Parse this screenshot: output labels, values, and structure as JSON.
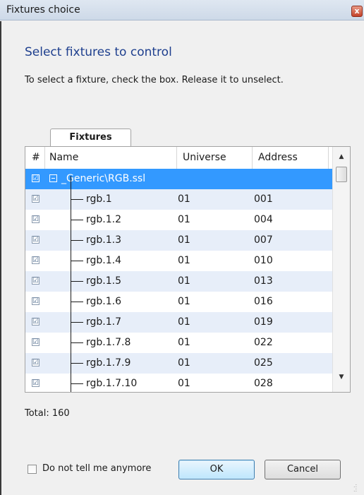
{
  "window": {
    "title": "Fixtures choice",
    "close_label": "x"
  },
  "dialog": {
    "heading": "Select fixtures to control",
    "instructions": "To select a fixture, check the box. Release it to unselect."
  },
  "tab": {
    "label": "Fixtures"
  },
  "grid": {
    "columns": [
      "#",
      "Name",
      "Universe",
      "Address"
    ],
    "group": {
      "checked": true,
      "name": "_Generic\\RGB.ssl"
    },
    "rows": [
      {
        "checked": true,
        "name": "rgb.1",
        "universe": "01",
        "address": "001"
      },
      {
        "checked": true,
        "name": "rgb.1.2",
        "universe": "01",
        "address": "004"
      },
      {
        "checked": true,
        "name": "rgb.1.3",
        "universe": "01",
        "address": "007"
      },
      {
        "checked": true,
        "name": "rgb.1.4",
        "universe": "01",
        "address": "010"
      },
      {
        "checked": true,
        "name": "rgb.1.5",
        "universe": "01",
        "address": "013"
      },
      {
        "checked": true,
        "name": "rgb.1.6",
        "universe": "01",
        "address": "016"
      },
      {
        "checked": true,
        "name": "rgb.1.7",
        "universe": "01",
        "address": "019"
      },
      {
        "checked": true,
        "name": "rgb.1.7.8",
        "universe": "01",
        "address": "022"
      },
      {
        "checked": true,
        "name": "rgb.1.7.9",
        "universe": "01",
        "address": "025"
      },
      {
        "checked": true,
        "name": "rgb.1.7.10",
        "universe": "01",
        "address": "028"
      }
    ]
  },
  "total_label": "Total: 160",
  "footer": {
    "dont_tell_label": "Do not tell me anymore",
    "dont_tell_checked": false,
    "ok_label": "OK",
    "cancel_label": "Cancel"
  },
  "colors": {
    "heading": "#1e3f8e",
    "selection": "#3399ff",
    "alt_row": "#e7eef9"
  }
}
